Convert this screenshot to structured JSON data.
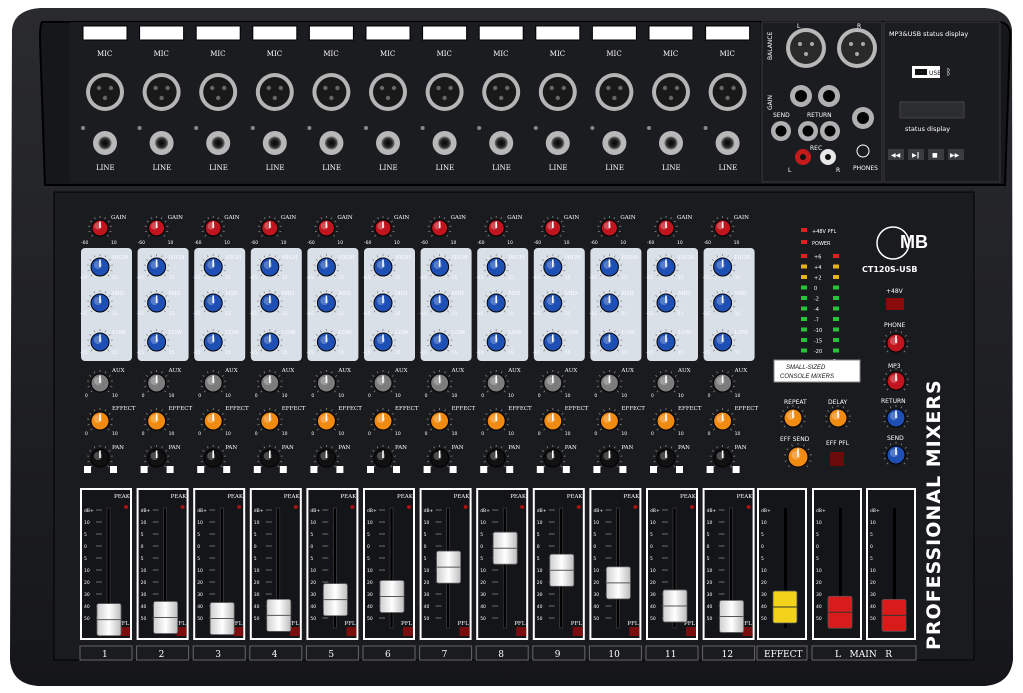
{
  "channels": {
    "numbers": [
      "1",
      "2",
      "3",
      "4",
      "5",
      "6",
      "7",
      "8",
      "9",
      "10",
      "11",
      "12"
    ],
    "mic_label": "MIC",
    "line_label": "LINE",
    "gain_label": "GAIN",
    "gain_scale": [
      "-60",
      "10"
    ],
    "eq_labels": [
      "HIGH",
      "MID",
      "LOW"
    ],
    "eq_scale": [
      "-15",
      "15"
    ],
    "aux_label": "AUX",
    "effect_label": "EFFECT",
    "pan_label": "PAN",
    "send_scale": [
      "0",
      "10"
    ],
    "pan_scale": [
      "L",
      "R"
    ],
    "peak_label": "PEAK",
    "pfl_label": "PFL",
    "fader_scale": [
      "dB+",
      "10",
      "5",
      "0",
      "5",
      "10",
      "20",
      "30",
      "40",
      "50"
    ],
    "fader_levels": [
      0.08,
      0.1,
      0.09,
      0.12,
      0.27,
      0.3,
      0.58,
      0.76,
      0.55,
      0.43,
      0.21,
      0.11
    ],
    "bottom_labels": [
      "1",
      "2",
      "3",
      "4",
      "5",
      "6",
      "7",
      "8",
      "9",
      "10",
      "11",
      "12"
    ]
  },
  "master_io": {
    "balance_label": "BALANCE",
    "l_label": "L",
    "r_label": "R",
    "gain_label": "GAIN",
    "send_label": "SEND",
    "return_label": "RETURN",
    "rec_label": "REC",
    "phones_label": "PHONES",
    "mp3_title": "MP3&USB status display",
    "usb_label": "USB",
    "status_label": "status display"
  },
  "meter": {
    "top_labels": [
      "+48V PFL",
      "POWER"
    ],
    "levels": [
      "+6",
      "+4",
      "+2",
      "0",
      "-2",
      "-4",
      "-7",
      "-10",
      "-15",
      "-20"
    ],
    "lr_label": [
      "L",
      "R"
    ]
  },
  "brand": {
    "logo_text": "MB",
    "model": "CT120S-USB",
    "tagline_1": "SMALL-SIZED",
    "tagline_2": "CONSOLE MIXERS",
    "vertical_text": "PROFESSIONAL MIXERS"
  },
  "effects": {
    "repeat_label": "REPEAT",
    "delay_label": "DELAY",
    "eff_send_label": "EFF SEND",
    "eff_pfl_label": "EFF PFL"
  },
  "master_controls": {
    "v48_label": "+48V",
    "phone_label": "PHONE",
    "mp3_label": "MP3",
    "return_label": "RETURN",
    "send_label": "SEND"
  },
  "faders": {
    "effect_level": 0.2,
    "main_l_level": 0.15,
    "main_r_level": 0.12,
    "effect_label": "EFFECT",
    "main_label": "L   MAIN   R"
  },
  "colors": {
    "body": "#1e1f22",
    "eq_panel": "#d9e0e8",
    "gain_knob": "#c0151f",
    "eq_knob": "#1e4fb4",
    "aux_knob": "#7c7c7c",
    "effect_knob": "#f08a10",
    "pan_knob": "#111111",
    "fader_cap": "#f2f2f2",
    "effect_fader_cap": "#f2d21a",
    "main_fader_cap": "#d81c1c"
  }
}
